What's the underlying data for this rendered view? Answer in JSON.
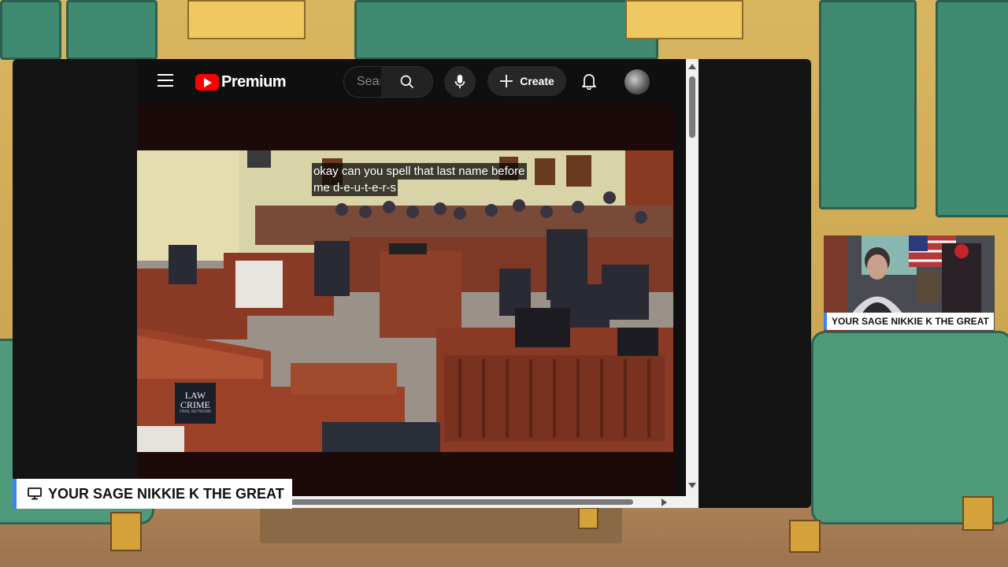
{
  "header": {
    "brand": "Premium",
    "search_placeholder": "Search",
    "create_label": "Create"
  },
  "icons": {
    "menu": "menu-icon",
    "logo": "youtube-logo-icon",
    "search": "search-icon",
    "mic": "mic-icon",
    "create": "plus-icon",
    "notifications": "bell-icon",
    "share": "monitor-icon"
  },
  "video": {
    "caption_line1": "okay can you spell that last name before",
    "caption_line2": "me d-e-u-t-e-r-s",
    "watermark_line1": "LAW",
    "watermark_line2": "CRIME",
    "watermark_small": "TRIAL NETWORK"
  },
  "overlays": {
    "screen_share_label": "YOUR SAGE NIKKIE K THE GREAT",
    "camera_label": "YOUR SAGE NIKKIE K THE GREAT"
  },
  "colors": {
    "youtube_red": "#ff0000",
    "label_accent": "#3b82f6",
    "dark_bg": "#0f0f0f"
  }
}
